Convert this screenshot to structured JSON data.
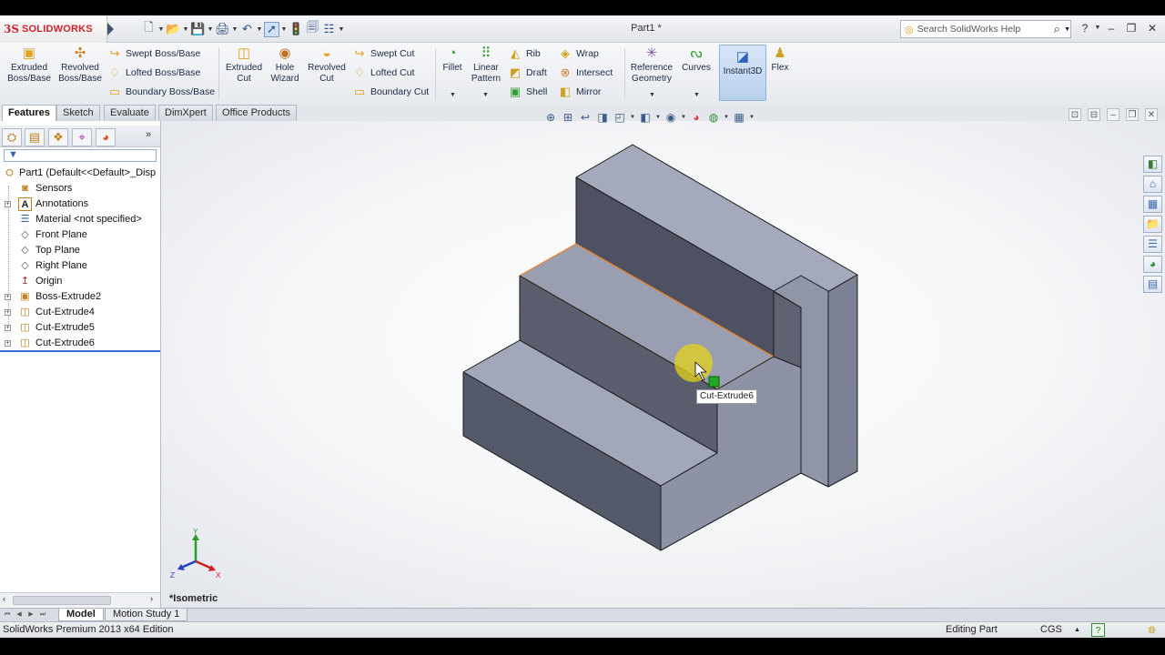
{
  "app": {
    "brand": "SOLIDWORKS",
    "brand_prefix": "3S",
    "doc_title": "Part1 *",
    "search_placeholder": "Search SolidWorks Help"
  },
  "ribbon": {
    "extruded_boss": "Extruded Boss/Base",
    "revolved_boss": "Revolved Boss/Base",
    "swept_boss": "Swept Boss/Base",
    "lofted_boss": "Lofted Boss/Base",
    "boundary_boss": "Boundary Boss/Base",
    "extruded_cut": "Extruded Cut",
    "hole_wizard": "Hole Wizard",
    "revolved_cut": "Revolved Cut",
    "swept_cut": "Swept Cut",
    "lofted_cut": "Lofted Cut",
    "boundary_cut": "Boundary Cut",
    "fillet": "Fillet",
    "linear_pattern": "Linear Pattern",
    "rib": "Rib",
    "draft": "Draft",
    "shell": "Shell",
    "wrap": "Wrap",
    "intersect": "Intersect",
    "mirror": "Mirror",
    "reference_geometry": "Reference Geometry",
    "curves": "Curves",
    "instant3d": "Instant3D",
    "flex": "Flex"
  },
  "tabs": [
    "Features",
    "Sketch",
    "Evaluate",
    "DimXpert",
    "Office Products"
  ],
  "tree": {
    "root": "Part1  (Default<<Default>_Disp",
    "items": [
      {
        "label": "Sensors",
        "icon": "sensors-icon",
        "expand": false
      },
      {
        "label": "Annotations",
        "icon": "annotations-icon",
        "expand": true
      },
      {
        "label": "Material <not specified>",
        "icon": "material-icon",
        "expand": false
      },
      {
        "label": "Front Plane",
        "icon": "plane-icon",
        "expand": false
      },
      {
        "label": "Top Plane",
        "icon": "plane-icon",
        "expand": false
      },
      {
        "label": "Right Plane",
        "icon": "plane-icon",
        "expand": false
      },
      {
        "label": "Origin",
        "icon": "origin-icon",
        "expand": false
      },
      {
        "label": "Boss-Extrude2",
        "icon": "extrude-icon",
        "expand": true
      },
      {
        "label": "Cut-Extrude4",
        "icon": "cut-icon",
        "expand": true
      },
      {
        "label": "Cut-Extrude5",
        "icon": "cut-icon",
        "expand": true
      },
      {
        "label": "Cut-Extrude6",
        "icon": "cut-icon",
        "expand": true
      }
    ]
  },
  "viewport": {
    "view_name": "*Isometric",
    "tooltip": "Cut-Extrude6",
    "triad": {
      "x": "X",
      "y": "Y",
      "z": "Z"
    }
  },
  "bottom_tabs": [
    "Model",
    "Motion Study 1"
  ],
  "status": {
    "edition": "SolidWorks Premium 2013 x64 Edition",
    "mode": "Editing Part",
    "units": "CGS"
  },
  "colors": {
    "brand": "#d2232a",
    "model_face": "#8f95a8",
    "highlight_edge": "#f08020",
    "cursor_halo": "#e6d21a",
    "selection_marker": "#22aa22"
  }
}
